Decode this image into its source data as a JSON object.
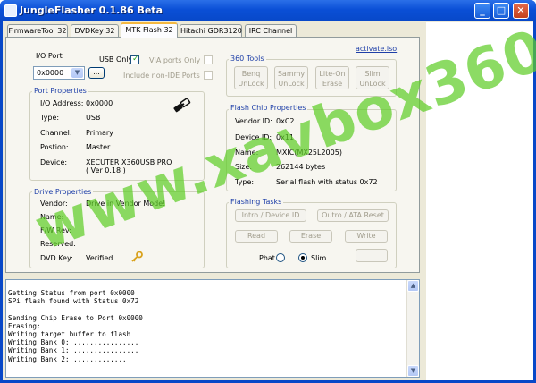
{
  "window": {
    "title": "JungleFlasher 0.1.86 Beta",
    "min": "_",
    "max": "□",
    "close": "✕"
  },
  "tabs": [
    {
      "label": "FirmwareTool 32"
    },
    {
      "label": "DVDKey 32"
    },
    {
      "label": "MTK Flash 32"
    },
    {
      "label": "Hitachi GDR3120"
    },
    {
      "label": "IRC Channel"
    }
  ],
  "io": {
    "label": "I/O Port",
    "port_value": "0x0000",
    "browse_label": "...",
    "usb_only": "USB Only",
    "via_only": "VIA ports Only",
    "include_non_ide": "Include non-IDE Ports"
  },
  "port_props": {
    "title": "Port Properties",
    "rows": [
      {
        "label": "I/O Address:",
        "value": "0x0000"
      },
      {
        "label": "Type:",
        "value": "USB"
      },
      {
        "label": "Channel:",
        "value": "Primary"
      },
      {
        "label": "Postion:",
        "value": "Master"
      },
      {
        "label": "Device:",
        "value": "XECUTER X360USB PRO"
      }
    ],
    "device_version": "( Ver 0.18 )"
  },
  "drive_props": {
    "title": "Drive Properties",
    "rows": [
      {
        "label": "Vendor:",
        "value": "Drive in Vendor Mode!"
      },
      {
        "label": "Name:",
        "value": ""
      },
      {
        "label": "F/W Rev:",
        "value": ""
      },
      {
        "label": "Reserved:",
        "value": ""
      },
      {
        "label": "DVD Key:",
        "value": "Verified"
      }
    ]
  },
  "tools": {
    "title": "360 Tools",
    "activate_link": "activate.iso",
    "buttons": [
      {
        "line1": "Benq",
        "line2": "UnLock"
      },
      {
        "line1": "Sammy",
        "line2": "UnLock"
      },
      {
        "line1": "Lite-On",
        "line2": "Erase"
      },
      {
        "line1": "Slim",
        "line2": "UnLock"
      }
    ]
  },
  "flash_chip": {
    "title": "Flash Chip Properties",
    "rows": [
      {
        "label": "Vendor ID:",
        "value": "0xC2"
      },
      {
        "label": "Device ID:",
        "value": "0x11"
      },
      {
        "label": "Name:",
        "value": "MXIC(MX25L2005)"
      },
      {
        "label": "Size:",
        "value": "262144 bytes"
      },
      {
        "label": "Type:",
        "value": "Serial flash with status 0x72"
      }
    ]
  },
  "flashing": {
    "title": "Flashing Tasks",
    "intro": "Intro / Device ID",
    "outro": "Outro / ATA Reset",
    "read": "Read",
    "erase": "Erase",
    "write": "Write",
    "phat": "Phat",
    "slim": "Slim"
  },
  "log_lines": [
    "Getting Status from port 0x0000",
    "SPi flash found with Status 0x72",
    "",
    "Sending Chip Erase to Port 0x0000",
    "Erasing:",
    "Writing target buffer to flash",
    "Writing Bank 0: ................",
    "Writing Bank 1: ................",
    "Writing Bank 2: ............."
  ],
  "watermark": "www.xavbox360.com",
  "colors": {
    "titlebar": "#0a4fd6",
    "client": "#ece9d8",
    "group_title": "#1e3fa8",
    "watermark": "#5fcd28"
  }
}
